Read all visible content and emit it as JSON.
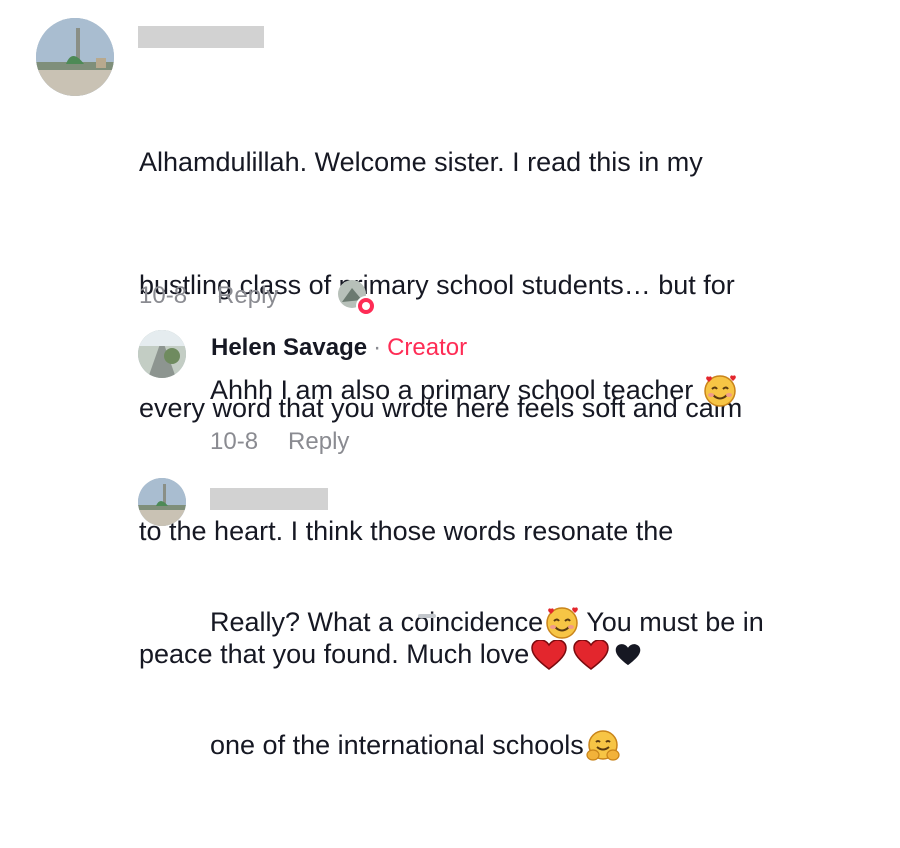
{
  "comment1": {
    "avatar": "mosque-dome-avatar",
    "username_redacted": true,
    "lines": [
      "Alhamdulillah. Welcome sister. I read this in my",
      "bustling class of primary school students… but for",
      "every word that you wrote here feels soft and calm",
      "to the heart. I think those words resonate the",
      "peace that you found. Much love"
    ],
    "emojis": [
      "red-heart",
      "red-heart",
      "black-heart"
    ],
    "date": "10-8",
    "reply_label": "Reply",
    "creator_liked_icon": "creator-like-avatar"
  },
  "reply1": {
    "avatar": "road-avatar",
    "author": "Helen Savage",
    "separator": "·",
    "badge": "Creator",
    "text": "Ahhh I am also a primary school teacher",
    "emoji": "smiling-face-with-hearts",
    "date": "10-8",
    "reply_label": "Reply"
  },
  "reply2": {
    "avatar": "mosque-dome-avatar",
    "username_redacted": true,
    "line1": "Really? What a coincidence",
    "line1_emoji": "smiling-face-with-hearts",
    "line1_rest": " You must be in",
    "line2": "one of the international schools",
    "line2_emoji": "hugging-face"
  },
  "colors": {
    "text": "#161823",
    "muted": "#8a8b91",
    "creator": "#fe2c55",
    "redaction": "#d2d2d2"
  }
}
